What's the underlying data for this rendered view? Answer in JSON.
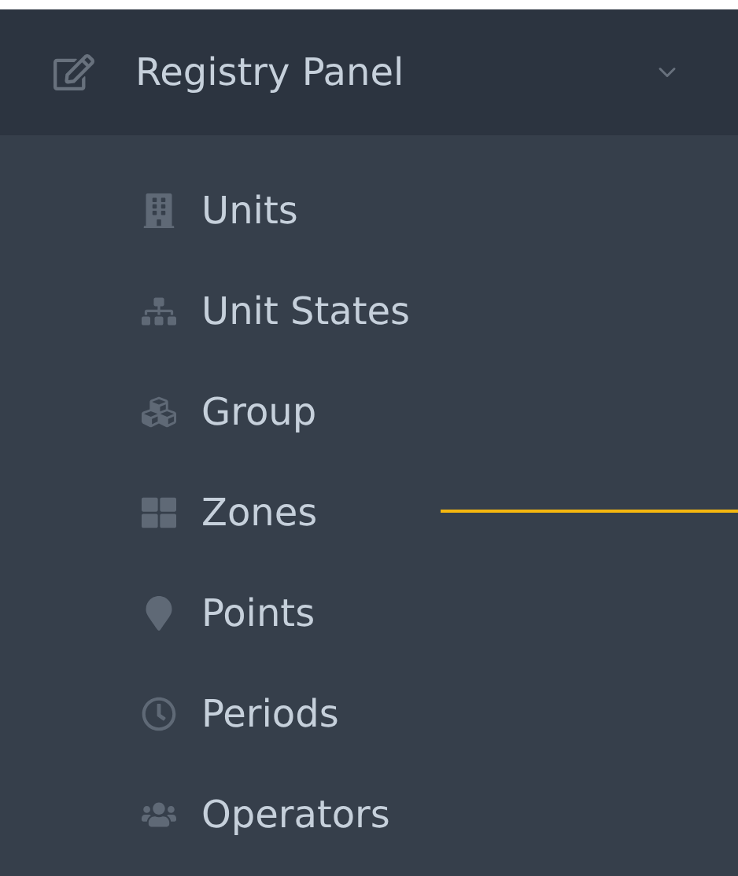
{
  "menu": {
    "title": "Registry Panel",
    "expanded": true,
    "items": [
      {
        "label": "Units"
      },
      {
        "label": "Unit States"
      },
      {
        "label": "Group"
      },
      {
        "label": "Zones"
      },
      {
        "label": "Points"
      },
      {
        "label": "Periods"
      },
      {
        "label": "Operators"
      }
    ]
  }
}
